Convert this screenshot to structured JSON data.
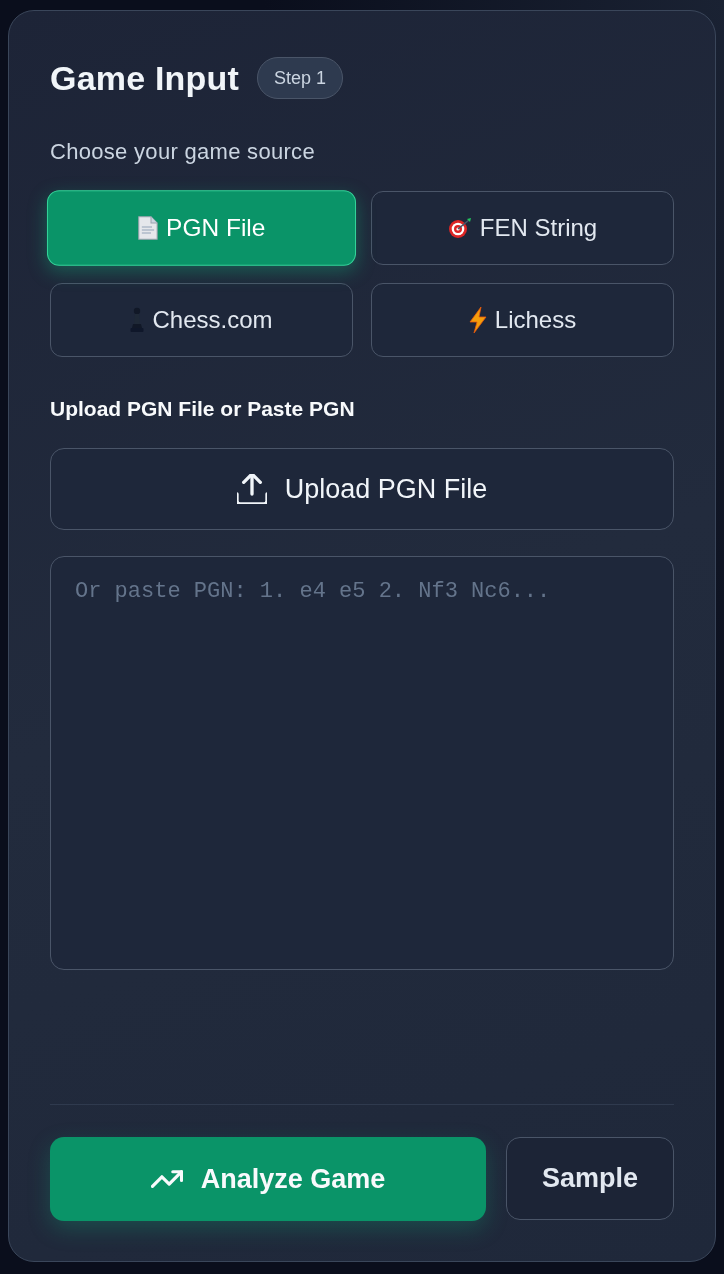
{
  "card": {
    "title": "Game Input",
    "badge": "Step 1"
  },
  "source_prompt": "Choose your game source",
  "sources": [
    {
      "kind": "pgn",
      "label": "PGN File",
      "selected": true
    },
    {
      "kind": "fen",
      "label": "FEN String",
      "selected": false
    },
    {
      "kind": "chesscom",
      "label": "Chess.com",
      "selected": false
    },
    {
      "kind": "lichess",
      "label": "Lichess",
      "selected": false
    }
  ],
  "input_label": "Upload PGN File or Paste PGN",
  "upload_button": "Upload PGN File",
  "pgn_field": {
    "placeholder": "Or paste PGN: 1. e4 e5 2. Nf3 Nc6..."
  },
  "actions": {
    "analyze": "Analyze Game",
    "sample": "Sample"
  }
}
